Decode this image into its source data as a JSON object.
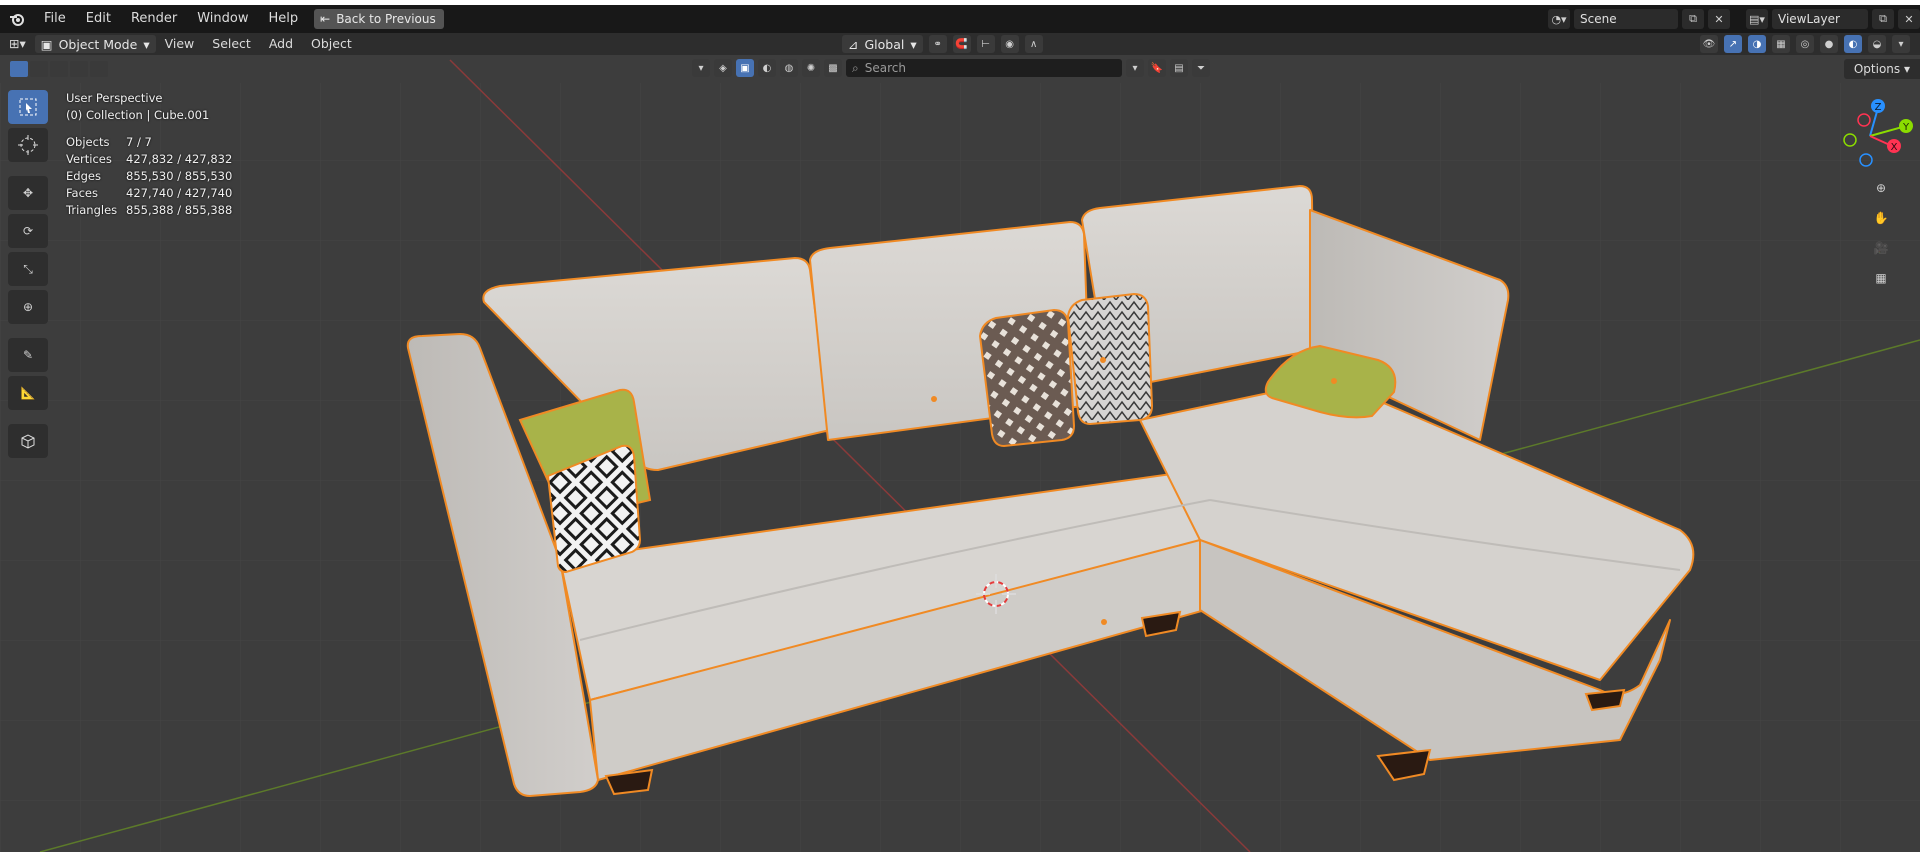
{
  "menubar": {
    "items": [
      "File",
      "Edit",
      "Render",
      "Window",
      "Help"
    ],
    "back_button": "Back to Previous",
    "scene_name": "Scene",
    "view_layer": "ViewLayer"
  },
  "header": {
    "mode": "Object Mode",
    "menus": [
      "View",
      "Select",
      "Add",
      "Object"
    ],
    "transform_orientation": "Global"
  },
  "subheader": {
    "search_placeholder": "Search",
    "options_label": "Options"
  },
  "viewport": {
    "view_name": "User Perspective",
    "collection_info": "(0) Collection | Cube.001",
    "stats": [
      {
        "label": "Objects",
        "value": "7 / 7"
      },
      {
        "label": "Vertices",
        "value": "427,832 / 427,832"
      },
      {
        "label": "Edges",
        "value": "855,530 / 855,530"
      },
      {
        "label": "Faces",
        "value": "427,740 / 427,740"
      },
      {
        "label": "Triangles",
        "value": "855,388 / 855,388"
      }
    ],
    "gizmo_axes": [
      "X",
      "Y",
      "Z"
    ]
  },
  "toolbar": {
    "tools": [
      "select-box",
      "cursor",
      "move",
      "rotate",
      "scale",
      "transform",
      "annotate",
      "measure",
      "add-cube"
    ]
  },
  "colors": {
    "background": "#3d3d3d",
    "selection_outline": "#f08a24",
    "accent": "#4772b3",
    "axis_x": "#ff3352",
    "axis_y": "#8bdc00",
    "axis_z": "#2890ff"
  }
}
